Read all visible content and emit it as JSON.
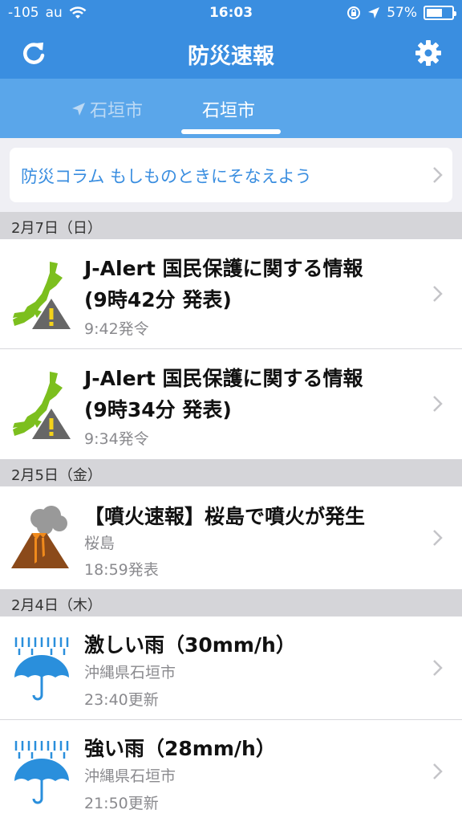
{
  "status_bar": {
    "signal": "-105",
    "carrier": "au",
    "time": "16:03",
    "battery": "57%",
    "battery_level": 0.57
  },
  "navbar": {
    "title": "防災速報",
    "refresh_icon": "refresh-icon",
    "settings_icon": "gear-icon"
  },
  "tabs": [
    {
      "label": "石垣市",
      "icon": "location-arrow-icon",
      "selected": false
    },
    {
      "label": "石垣市",
      "selected": true
    }
  ],
  "column": {
    "label": "防災コラム もしものときにそなえよう"
  },
  "sections": [
    {
      "date": "2月7日（日）",
      "items": [
        {
          "icon": "j-alert-icon",
          "title_line1": "J-Alert 国民保護に関する情報",
          "title_line2": "(9時42分 発表)",
          "sub1": "9:42発令"
        },
        {
          "icon": "j-alert-icon",
          "title_line1": "J-Alert 国民保護に関する情報",
          "title_line2": "(9時34分 発表)",
          "sub1": "9:34発令"
        }
      ]
    },
    {
      "date": "2月5日（金）",
      "items": [
        {
          "icon": "volcano-icon",
          "title_line1": "【噴火速報】桜島で噴火が発生",
          "sub1": "桜島",
          "sub2": "18:59発表"
        }
      ]
    },
    {
      "date": "2月4日（木）",
      "items": [
        {
          "icon": "heavy-rain-umbrella-icon",
          "title_line1": "激しい雨（30mm/h）",
          "sub1": "沖縄県石垣市",
          "sub2": "23:40更新"
        },
        {
          "icon": "heavy-rain-umbrella-icon",
          "title_line1": "強い雨（28mm/h）",
          "sub1": "沖縄県石垣市",
          "sub2": "21:50更新"
        }
      ]
    }
  ],
  "colors": {
    "header_blue": "#3a8ee0",
    "tab_blue": "#5aa6ea",
    "link_blue": "#3a8ee0",
    "alert_green": "#7cbf1e",
    "volcano_brown": "#8b4a1a",
    "rain_blue": "#2a8fdc"
  }
}
